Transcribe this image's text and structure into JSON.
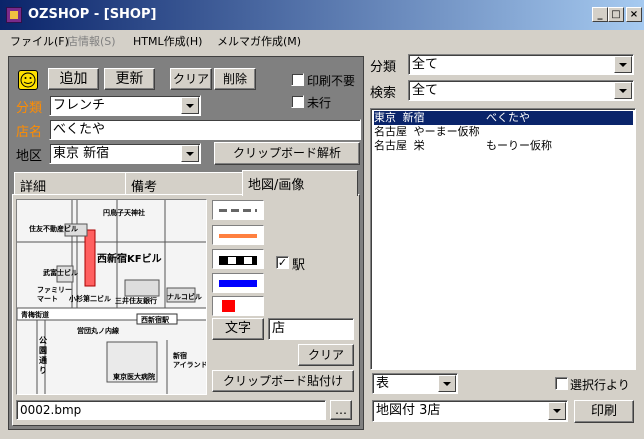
{
  "window": {
    "title": "OZSHOP - [SHOP]",
    "minimize": "_",
    "maximize": "□",
    "close": "×"
  },
  "menu": [
    {
      "label": "ファイル(F)",
      "enabled": true
    },
    {
      "label": "店情報(S)",
      "enabled": false
    },
    {
      "label": "HTML作成(H)",
      "enabled": true
    },
    {
      "label": "メルマガ作成(M)",
      "enabled": true
    }
  ],
  "toolbar": {
    "add": "追加",
    "update": "更新",
    "clear": "クリア",
    "delete": "削除",
    "no_print": "印刷不要",
    "not_visited": "未行"
  },
  "form": {
    "category_label": "分類",
    "category_value": "フレンチ",
    "name_label": "店名",
    "name_value": "べくたや",
    "area_label": "地区",
    "area_value": "東京 新宿",
    "clipboard_parse": "クリップボード解析"
  },
  "tabs": [
    "詳細",
    "備考",
    "地図/画像"
  ],
  "active_tab": 2,
  "map": {
    "labels": {
      "shrine": "円鳥子天神社",
      "building1": "住友不動産ビル",
      "kf_building": "西新宿KFビル",
      "shop_building": "武富士ビル",
      "familymart": "ファミリー\nマート",
      "koike_building": "小杉第二ビル",
      "mitsui": "三井住友銀行",
      "nalco": "ナルコビル",
      "ome": "青梅街道",
      "station": "西新宿駅",
      "marunouchi": "営団丸ノ内線",
      "koshu": "公園通り",
      "hospital": "東京医大病院",
      "island": "新宿\nアイランド"
    }
  },
  "tools": {
    "station_checkbox": "駅",
    "text_button": "文字",
    "text_value": "店",
    "clear": "クリア",
    "paste": "クリップボード貼付け"
  },
  "image_file": "0002.bmp",
  "browse": "…",
  "right": {
    "category_label": "分類",
    "category_value": "全て",
    "search_label": "検索",
    "search_value": "全て",
    "list": [
      {
        "area": "東京 新宿",
        "name": "べくたや",
        "selected": true
      },
      {
        "area": "名古屋 やーまー仮称",
        "name": "",
        "selected": false
      },
      {
        "area": "名古屋 栄",
        "name": "もーりー仮称",
        "selected": false
      }
    ],
    "view_value": "表",
    "select_row": "選択行より",
    "print_value": "地図付 3店",
    "print_button": "印刷"
  },
  "colors": {
    "title_start": "#0a246a",
    "title_end": "#a6caf0",
    "label_orange": "#ff8c00",
    "line_orange": "#ff8040",
    "line_blue": "#0000ff",
    "fill_red": "#ff0000"
  }
}
